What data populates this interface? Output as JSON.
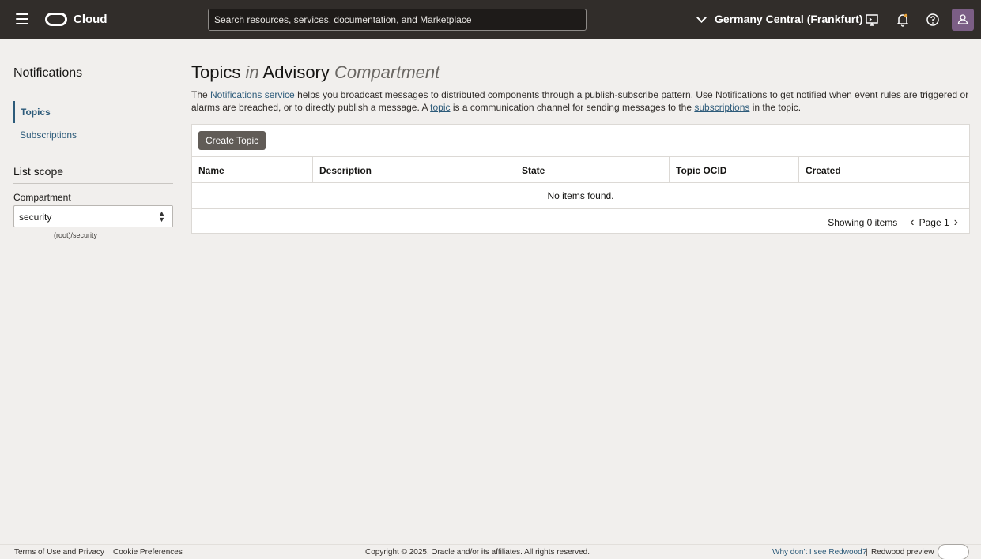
{
  "header": {
    "brand": "Cloud",
    "search_placeholder": "Search resources, services, documentation, and Marketplace",
    "region": "Germany Central (Frankfurt)"
  },
  "nav": {
    "title": "Notifications",
    "items": [
      {
        "label": "Topics",
        "active": true
      },
      {
        "label": "Subscriptions",
        "active": false
      }
    ],
    "scope_title": "List scope",
    "compartment_label": "Compartment",
    "compartment_value": "security",
    "compartment_path": "(root)/security"
  },
  "main": {
    "title_part1": "Topics",
    "title_part2": "in",
    "title_part3": "Advisory",
    "title_part4": "Compartment",
    "desc": {
      "t1": "The ",
      "link1": "Notifications service",
      "t2": " helps you broadcast messages to distributed components through a publish-subscribe pattern. Use Notifications to get notified when event rules are triggered or alarms are breached, or to directly publish a message. A ",
      "link2": "topic",
      "t3": " is a communication channel for sending messages to the ",
      "link3": "subscriptions",
      "t4": " in the topic."
    },
    "create_button": "Create Topic",
    "columns": [
      "Name",
      "Description",
      "State",
      "Topic OCID",
      "Created"
    ],
    "empty_text": "No items found.",
    "showing": "Showing 0 items",
    "page": "Page 1"
  },
  "footer": {
    "terms": "Terms of Use and Privacy",
    "cookies": "Cookie Preferences",
    "copyright": "Copyright © 2025, Oracle and/or its affiliates. All rights reserved.",
    "why_redwood": "Why don't I see Redwood?",
    "separator": "|",
    "redwood_preview": "Redwood preview"
  },
  "colors": {
    "header_bg": "#312d2a",
    "link": "#2d5b7a",
    "button_bg": "#615c57",
    "avatar_bg": "#7b5e85"
  }
}
